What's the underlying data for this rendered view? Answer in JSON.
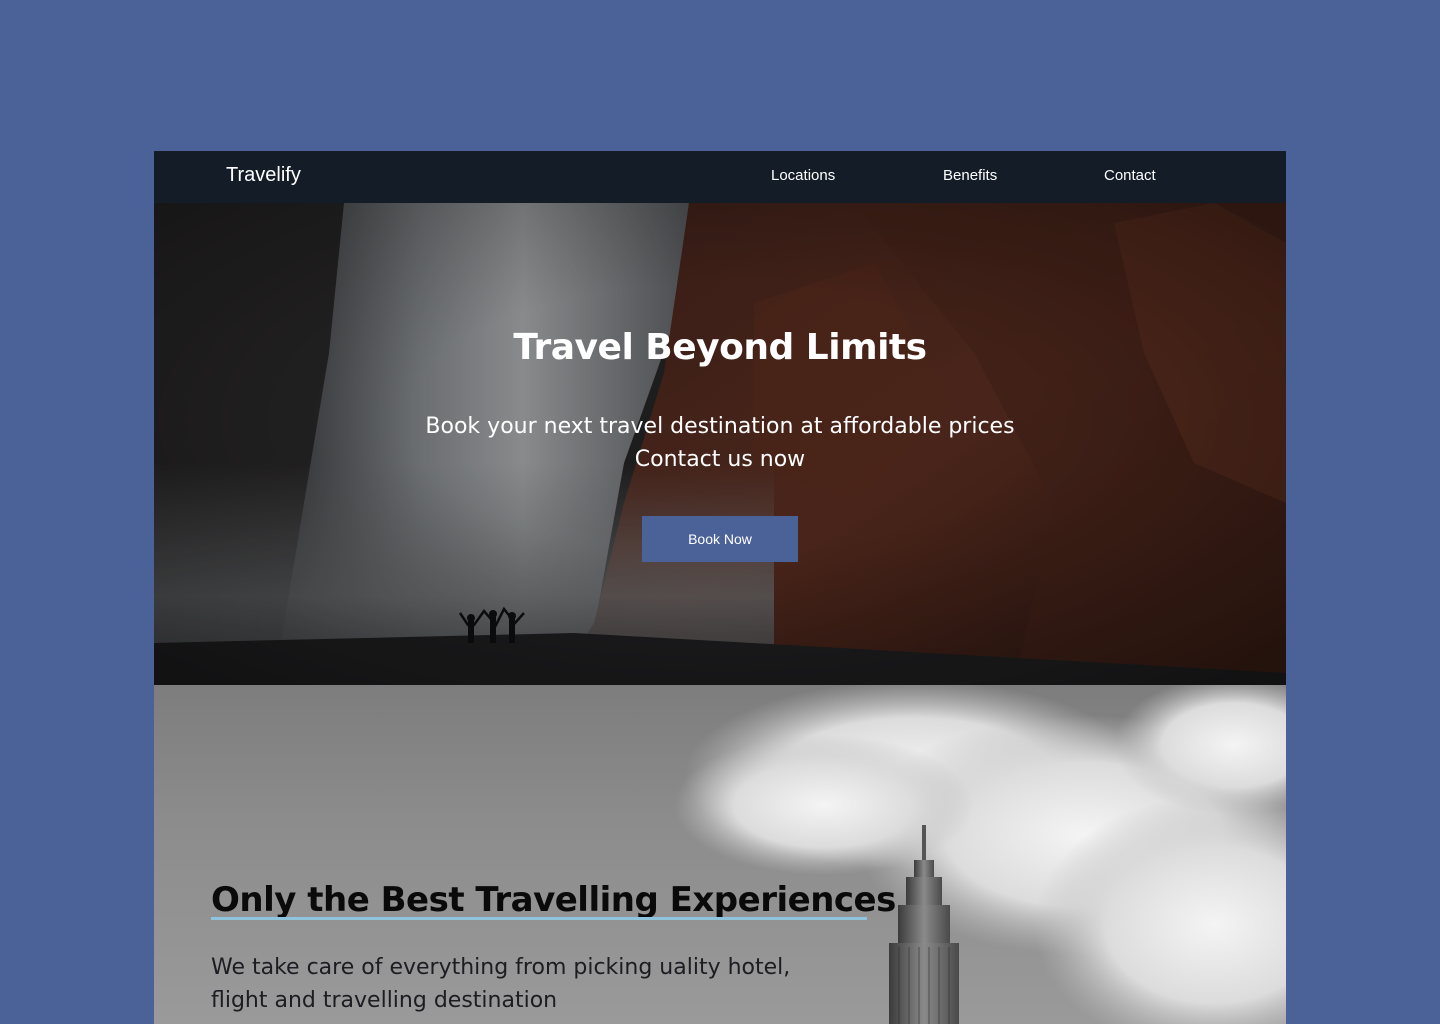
{
  "nav": {
    "brand": "Travelify",
    "links": [
      "Locations",
      "Benefits",
      "Contact"
    ]
  },
  "hero": {
    "title": "Travel Beyond Limits",
    "subtitle_line1": "Book your next travel destination at affordable prices",
    "subtitle_line2": "Contact us now",
    "cta_label": "Book Now",
    "image_icon": "waterfall-landscape-image"
  },
  "section2": {
    "title": "Only the Best Travelling Experiences",
    "text_line1": "We take care of everything from picking uality hotel,",
    "text_line2": "flight and travelling destination",
    "image_icon": "skyscraper-clouds-image"
  },
  "colors": {
    "page_background": "#4b6298",
    "nav_background": "#141c27",
    "button": "#4b6298",
    "underline_accent": "#8ec5dc"
  }
}
